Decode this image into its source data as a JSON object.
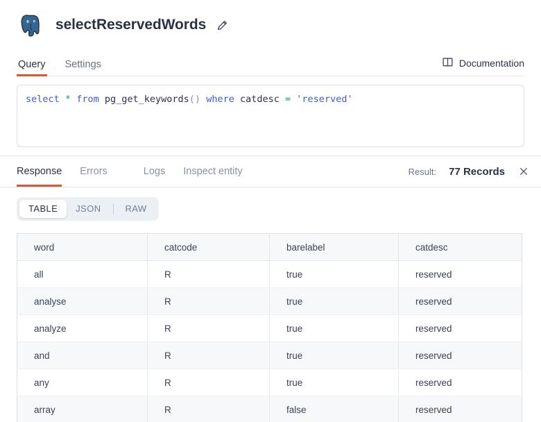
{
  "header": {
    "logo_icon": "postgresql-elephant-logo",
    "title": "selectReservedWords",
    "edit_icon": "pencil-icon"
  },
  "primary_tabs": {
    "items": [
      {
        "label": "Query",
        "active": true
      },
      {
        "label": "Settings",
        "active": false
      }
    ],
    "documentation": {
      "label": "Documentation",
      "icon": "book-open-icon"
    }
  },
  "editor": {
    "tokens": [
      {
        "text": "select",
        "type": "kw"
      },
      {
        "text": " ",
        "type": "idn"
      },
      {
        "text": "*",
        "type": "op"
      },
      {
        "text": " ",
        "type": "idn"
      },
      {
        "text": "from",
        "type": "kw"
      },
      {
        "text": " ",
        "type": "idn"
      },
      {
        "text": "pg_get_keywords",
        "type": "idn"
      },
      {
        "text": "()",
        "type": "pun"
      },
      {
        "text": " ",
        "type": "idn"
      },
      {
        "text": "where",
        "type": "kw"
      },
      {
        "text": " ",
        "type": "idn"
      },
      {
        "text": "catdesc",
        "type": "idn"
      },
      {
        "text": " ",
        "type": "idn"
      },
      {
        "text": "=",
        "type": "op"
      },
      {
        "text": " ",
        "type": "idn"
      },
      {
        "text": "'reserved'",
        "type": "str"
      }
    ],
    "plain_text": "select * from pg_get_keywords() where catdesc = 'reserved'"
  },
  "response": {
    "tabs": [
      {
        "label": "Response",
        "active": true
      },
      {
        "label": "Errors",
        "active": false
      },
      {
        "label": "Logs",
        "active": false
      },
      {
        "label": "Inspect entity",
        "active": false
      }
    ],
    "result_label": "Result:",
    "result_value": "77 Records",
    "close_icon": "close-icon"
  },
  "format_toggle": {
    "options": [
      {
        "label": "TABLE",
        "active": true
      },
      {
        "label": "JSON",
        "active": false
      },
      {
        "label": "RAW",
        "active": false
      }
    ]
  },
  "table": {
    "columns": [
      "word",
      "catcode",
      "barelabel",
      "catdesc"
    ],
    "rows": [
      [
        "all",
        "R",
        "true",
        "reserved"
      ],
      [
        "analyse",
        "R",
        "true",
        "reserved"
      ],
      [
        "analyze",
        "R",
        "true",
        "reserved"
      ],
      [
        "and",
        "R",
        "true",
        "reserved"
      ],
      [
        "any",
        "R",
        "true",
        "reserved"
      ],
      [
        "array",
        "R",
        "false",
        "reserved"
      ]
    ]
  },
  "colors": {
    "accent": "#e8522a",
    "keyword": "#3b5bdb",
    "operator": "#12957f",
    "text": "#2b3245",
    "muted": "#8792a2",
    "border": "#e3e8ee",
    "row_alt": "#f6f8fa",
    "logo_blue": "#336791"
  }
}
